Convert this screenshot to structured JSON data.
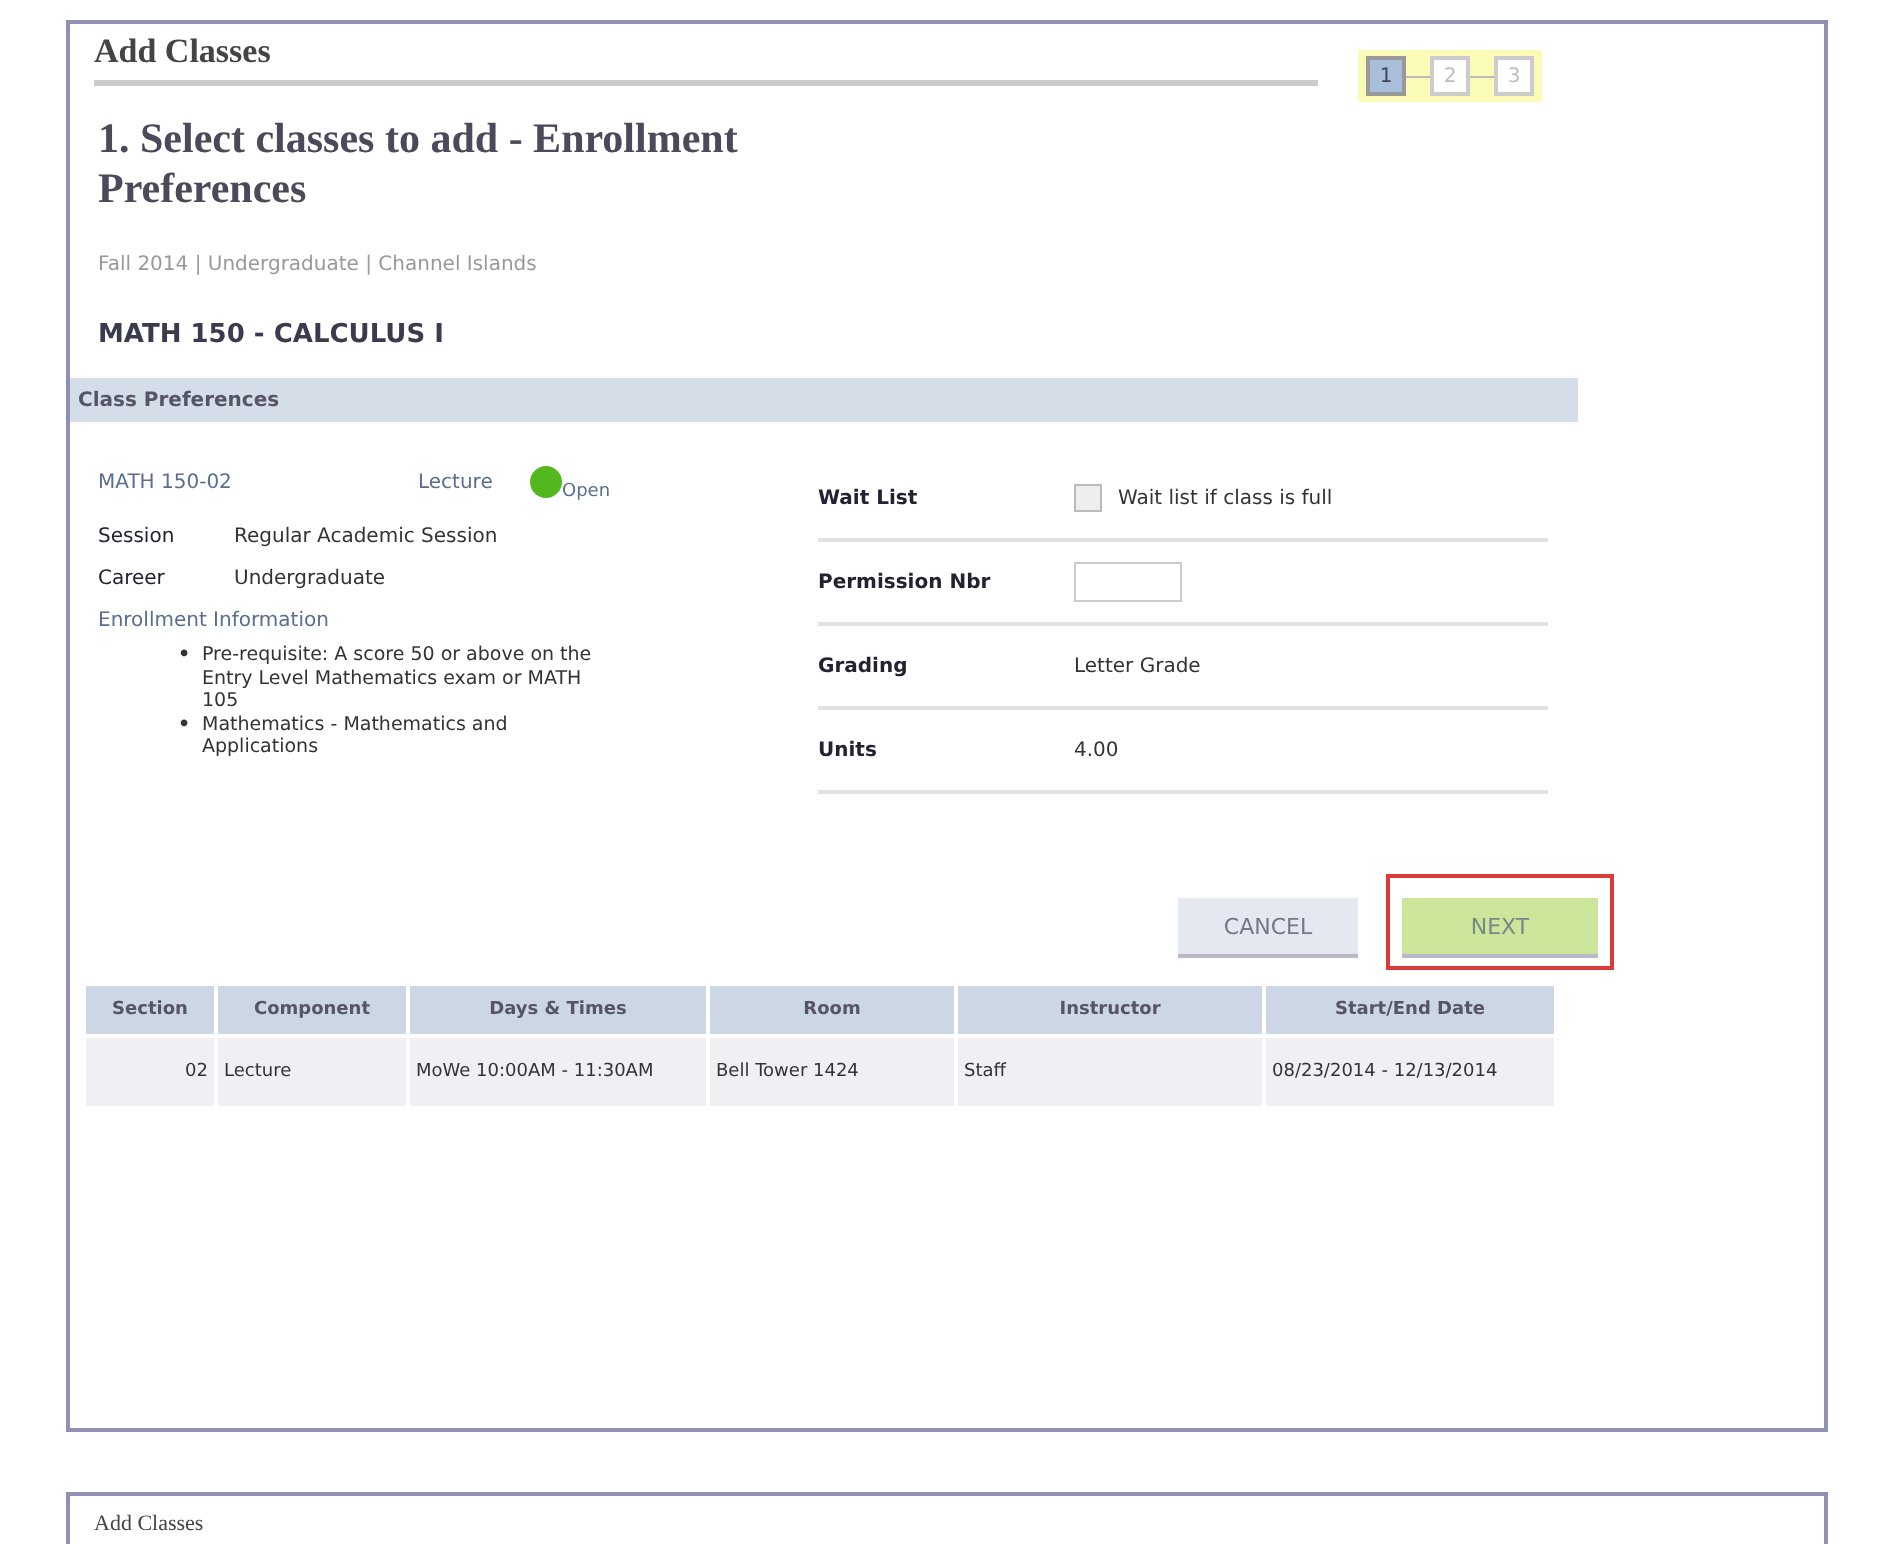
{
  "panel": {
    "title": "Add Classes",
    "steps": [
      {
        "label": "1",
        "selected": true
      },
      {
        "label": "2",
        "selected": false
      },
      {
        "label": "3",
        "selected": false
      }
    ],
    "heading": "1. Select classes to add - Enrollment Preferences",
    "context": "Fall 2014 | Undergraduate | Channel Islands",
    "course": "MATH 150 - CALCULUS I",
    "section_header": "Class Preferences",
    "class_section": "MATH 150-02",
    "component": "Lecture",
    "status": {
      "label": "Open",
      "color": "#52b81e"
    },
    "details": [
      {
        "label": "Session",
        "value": "Regular Academic Session"
      },
      {
        "label": "Career",
        "value": "Undergraduate"
      }
    ],
    "enrollment_info": {
      "label": "Enrollment Information",
      "items": [
        {
          "marker": "•",
          "text": "Pre-requisite: A score 50 or above on the Entry Level Mathematics exam or MATH 105"
        },
        {
          "marker": "•",
          "text": "Mathematics - Mathematics and Applications"
        }
      ]
    },
    "preferences": [
      {
        "kind": "checkbox",
        "label": "Wait List",
        "text": "Wait list if class is full",
        "checked": false
      },
      {
        "kind": "input",
        "label": "Permission Nbr"
      },
      {
        "kind": "text",
        "label": "Grading",
        "value": "Letter Grade"
      },
      {
        "kind": "text",
        "label": "Units",
        "value": "4.00"
      }
    ],
    "buttons": [
      {
        "kind": "secondary",
        "label": "CANCEL",
        "highlighted": false
      },
      {
        "kind": "primary",
        "label": "NEXT",
        "highlighted": true
      }
    ],
    "table": {
      "columns": [
        "Section",
        "Component",
        "Days & Times",
        "Room",
        "Instructor",
        "Start/End Date"
      ],
      "rows": [
        [
          "02",
          "Lecture",
          "MoWe 10:00AM - 11:30AM",
          "Bell Tower 1424",
          "Staff",
          "08/23/2014 - 12/13/2014"
        ]
      ]
    }
  },
  "next_panel": {
    "title": "Add Classes"
  }
}
